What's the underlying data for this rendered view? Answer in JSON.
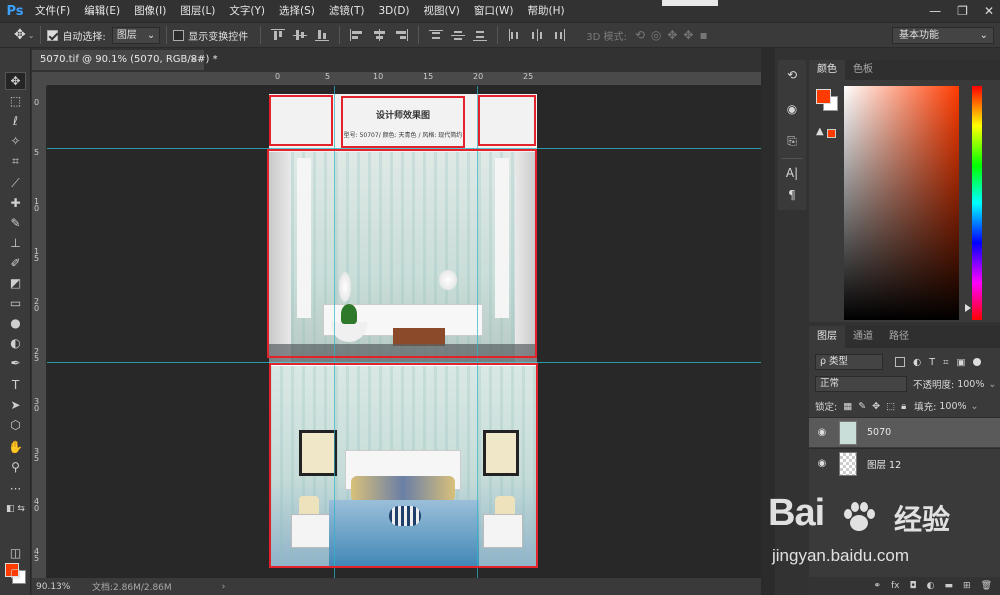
{
  "app": {
    "logo": "Ps"
  },
  "menu": [
    "文件(F)",
    "编辑(E)",
    "图像(I)",
    "图层(L)",
    "文字(Y)",
    "选择(S)",
    "滤镜(T)",
    "3D(D)",
    "视图(V)",
    "窗口(W)",
    "帮助(H)"
  ],
  "window_controls": {
    "minimize": "—",
    "restore": "❐",
    "close": "✕"
  },
  "options_bar": {
    "auto_select_label": "自动选择:",
    "auto_select_checked": true,
    "auto_select_target": "图层",
    "show_transform_label": "显示变换控件",
    "show_transform_checked": false,
    "mode_3d_label": "3D 模式:",
    "workspace": "基本功能"
  },
  "document_tab": {
    "title": "5070.tif @ 90.1% (5070, RGB/8#) *",
    "close": "×"
  },
  "ruler_h": [
    "0",
    "5",
    "10",
    "15",
    "20",
    "25"
  ],
  "ruler_v": [
    "0",
    "5",
    "1 0",
    "1 5",
    "2 0",
    "2 5",
    "3 0",
    "3 5",
    "4 0",
    "4 5"
  ],
  "document": {
    "header_title": "设计师效果图",
    "header_info": "型号: 50707/ 颜色: 天青色 / 风格: 现代简约"
  },
  "status": {
    "zoom": "90.13%",
    "doc_size": "文档:2.86M/2.86M",
    "arrow": "›"
  },
  "color_panel": {
    "tabs": [
      "颜色",
      "色板"
    ],
    "active_tab": 0,
    "fg_color": "#ff3b00",
    "bg_color": "#ffffff"
  },
  "layers_panel": {
    "tabs": [
      "图层",
      "通道",
      "路径"
    ],
    "active_tab": 0,
    "filter_label": "ρ 类型",
    "blend_mode": "正常",
    "opacity_label": "不透明度:",
    "opacity_value": "100%",
    "lock_label": "锁定:",
    "fill_label": "填充:",
    "fill_value": "100%",
    "layers": [
      {
        "name": "5070",
        "visible": true,
        "selected": true
      },
      {
        "name": "图层 12",
        "visible": true,
        "selected": false
      }
    ],
    "footer_icons": [
      "link-icon",
      "fx-icon",
      "mask-icon",
      "adjustment-icon",
      "folder-icon",
      "new-layer-icon",
      "trash-icon"
    ],
    "footer_fx": "fx"
  },
  "watermark": {
    "logo": "Bai",
    "brand": "经验",
    "url": "jingyan.baidu.com"
  },
  "colors": {
    "accent": "#3aa1ff",
    "highlight_box": "#e3232b",
    "guide": "#2bb7c7"
  }
}
